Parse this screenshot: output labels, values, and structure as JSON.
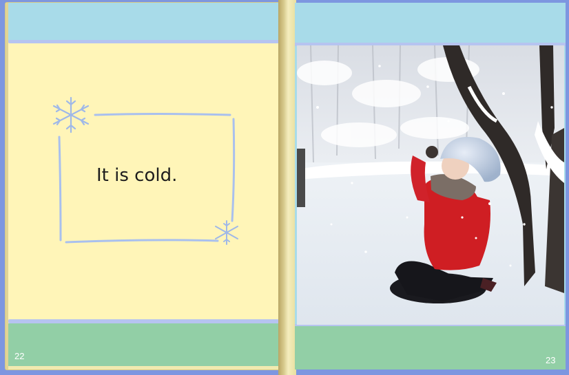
{
  "book": {
    "left_page": {
      "text": "It is cold.",
      "page_number": "22"
    },
    "right_page": {
      "page_number": "23",
      "photo_icon": "child-in-snow-photo"
    }
  },
  "colors": {
    "sky_band": "#a8dbe9",
    "page_yellow": "#fff5b8",
    "grass_band": "#92cfa6",
    "rule_blue": "#b6c4f0",
    "desk_blue": "#7d96e0"
  }
}
